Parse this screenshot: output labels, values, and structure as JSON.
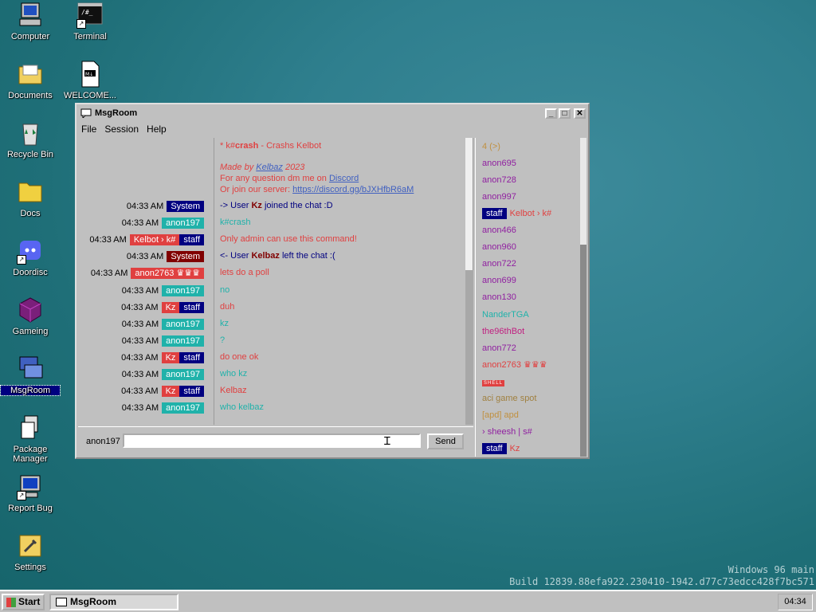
{
  "desktop": {
    "icons": [
      {
        "label": "Computer"
      },
      {
        "label": "Terminal"
      },
      {
        "label": "Documents"
      },
      {
        "label": "WELCOME..."
      },
      {
        "label": "Recycle Bin"
      },
      {
        "label": "Docs"
      },
      {
        "label": "Doordisc"
      },
      {
        "label": "Gameing"
      },
      {
        "label": "MsgRoom"
      },
      {
        "label": "Package Manager"
      },
      {
        "label": "Report Bug"
      },
      {
        "label": "Settings"
      }
    ],
    "watermark_line1": "Windows 96 main",
    "watermark_line2": "Build 12839.88efa922.230410-1942.d77c73edcc428f7bc571"
  },
  "window": {
    "title": "MsgRoom",
    "menu": [
      "File",
      "Session",
      "Help"
    ],
    "controls": {
      "min": "_",
      "max": "□",
      "close": "✕"
    }
  },
  "chat": {
    "intro": {
      "line1_prefix": "* k#",
      "line1_cmd": "crash",
      "line1_suffix": " - Crashs Kelbot",
      "made_prefix": "Made by ",
      "made_author": "Kelbaz",
      "made_suffix": " 2023",
      "dm_prefix": "For any question dm me on ",
      "dm_link": "Discord",
      "join_prefix": "Or join our server: ",
      "join_link": "https://discord.gg/bJXHfbR6aM"
    },
    "messages": [
      {
        "time": "04:33 AM",
        "tags": [
          {
            "text": "System",
            "cls": "b-system"
          }
        ],
        "text_prefix": "-> User ",
        "text_bold": "Kz",
        "text_suffix": " joined the chat :D",
        "color": "#000080"
      },
      {
        "time": "04:33 AM",
        "tags": [
          {
            "text": "anon197",
            "cls": "b-anon"
          }
        ],
        "text_prefix": "k#crash",
        "text_bold": "",
        "text_suffix": "",
        "color": "#20b2aa"
      },
      {
        "time": "04:33 AM",
        "tags": [
          {
            "text": "Kelbot › k#",
            "cls": "b-kelbot"
          },
          {
            "text": "staff",
            "cls": "b-staff"
          }
        ],
        "text_prefix": "Only admin can use this command!",
        "text_bold": "",
        "text_suffix": "",
        "color": "#e04040"
      },
      {
        "time": "04:33 AM",
        "tags": [
          {
            "text": "System",
            "cls": "b-system2"
          }
        ],
        "text_prefix": "<- User ",
        "text_bold": "Kelbaz",
        "text_suffix": " left the chat :(",
        "color": "#000080"
      },
      {
        "time": "04:33 AM",
        "tags": [
          {
            "text": "anon2763 ♛♛♛",
            "cls": "b-anon2763"
          }
        ],
        "text_prefix": "lets do a poll",
        "text_bold": "",
        "text_suffix": "",
        "color": "#e04040"
      },
      {
        "time": "04:33 AM",
        "tags": [
          {
            "text": "anon197",
            "cls": "b-anon"
          }
        ],
        "text_prefix": "no",
        "text_bold": "",
        "text_suffix": "",
        "color": "#20b2aa"
      },
      {
        "time": "04:33 AM",
        "tags": [
          {
            "text": "Kz",
            "cls": "b-kz"
          },
          {
            "text": "staff",
            "cls": "b-staff"
          }
        ],
        "text_prefix": "duh",
        "text_bold": "",
        "text_suffix": "",
        "color": "#e04040"
      },
      {
        "time": "04:33 AM",
        "tags": [
          {
            "text": "anon197",
            "cls": "b-anon"
          }
        ],
        "text_prefix": "kz",
        "text_bold": "",
        "text_suffix": "",
        "color": "#20b2aa"
      },
      {
        "time": "04:33 AM",
        "tags": [
          {
            "text": "anon197",
            "cls": "b-anon"
          }
        ],
        "text_prefix": "?",
        "text_bold": "",
        "text_suffix": "",
        "color": "#20b2aa"
      },
      {
        "time": "04:33 AM",
        "tags": [
          {
            "text": "Kz",
            "cls": "b-kz"
          },
          {
            "text": "staff",
            "cls": "b-staff"
          }
        ],
        "text_prefix": "do one ok",
        "text_bold": "",
        "text_suffix": "",
        "color": "#e04040"
      },
      {
        "time": "04:33 AM",
        "tags": [
          {
            "text": "anon197",
            "cls": "b-anon"
          }
        ],
        "text_prefix": "who kz",
        "text_bold": "",
        "text_suffix": "",
        "color": "#20b2aa"
      },
      {
        "time": "04:33 AM",
        "tags": [
          {
            "text": "Kz",
            "cls": "b-kz"
          },
          {
            "text": "staff",
            "cls": "b-staff"
          }
        ],
        "text_prefix": "Kelbaz",
        "text_bold": "",
        "text_suffix": "",
        "color": "#e04040"
      },
      {
        "time": "04:33 AM",
        "tags": [
          {
            "text": "anon197",
            "cls": "b-anon"
          }
        ],
        "text_prefix": "who kelbaz",
        "text_bold": "",
        "text_suffix": "",
        "color": "#20b2aa"
      }
    ],
    "input": {
      "username": "anon197",
      "value": "",
      "send_label": "Send"
    }
  },
  "users": [
    {
      "text": "4 (>)",
      "color": "#c09040"
    },
    {
      "text": "anon695",
      "color": "#9020a0"
    },
    {
      "text": "anon728",
      "color": "#9020a0"
    },
    {
      "text": "anon997",
      "color": "#9020a0"
    },
    {
      "text": "Kelbot › k#",
      "color": "#e04040",
      "staff": "staff"
    },
    {
      "text": "anon466",
      "color": "#9020a0"
    },
    {
      "text": "anon960",
      "color": "#9020a0"
    },
    {
      "text": "anon722",
      "color": "#9020a0"
    },
    {
      "text": "anon699",
      "color": "#9020a0"
    },
    {
      "text": "anon130",
      "color": "#9020a0"
    },
    {
      "text": "NanderTGA",
      "color": "#20b2aa"
    },
    {
      "text": "the96thBot",
      "color": "#c02080"
    },
    {
      "text": "anon772",
      "color": "#9020a0"
    },
    {
      "text": "anon2763 ♛♛♛",
      "color": "#e04040"
    },
    {
      "text": "SHELL",
      "color": "#e04040",
      "shell": true
    },
    {
      "text": "aci game spot",
      "color": "#a08040"
    },
    {
      "text": "[apd] apd",
      "color": "#c09040"
    },
    {
      "text": "› sheesh | s#",
      "color": "#9020a0"
    },
    {
      "text": "Kz",
      "color": "#e04040",
      "staff": "staff"
    }
  ],
  "taskbar": {
    "start": "Start",
    "task": "MsgRoom",
    "clock": "04:34"
  }
}
